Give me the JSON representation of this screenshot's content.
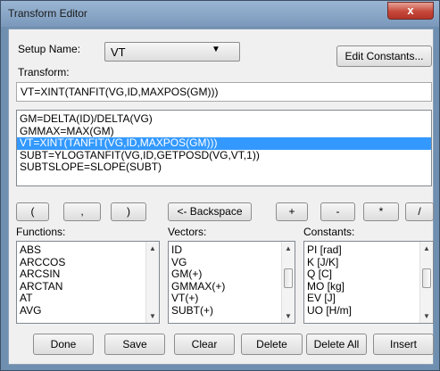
{
  "window": {
    "title": "Transform Editor",
    "close_glyph": "x"
  },
  "setup": {
    "label": "Setup Name:",
    "value": "VT",
    "arrow": "▼"
  },
  "edit_constants_label": "Edit Constants...",
  "transform": {
    "label": "Transform:",
    "value": "VT=XINT(TANFIT(VG,ID,MAXPOS(GM)))"
  },
  "transform_list": {
    "items": [
      "GM=DELTA(ID)/DELTA(VG)",
      "GMMAX=MAX(GM)",
      "VT=XINT(TANFIT(VG,ID,MAXPOS(GM)))",
      "SUBT=YLOGTANFIT(VG,ID,GETPOSD(VG,VT,1))",
      "SUBTSLOPE=SLOPE(SUBT)"
    ],
    "selected_index": 2
  },
  "keypad": {
    "open_paren": "(",
    "comma": ",",
    "close_paren": ")",
    "backspace": "<- Backspace",
    "plus": "+",
    "minus": "-",
    "multiply": "*",
    "divide": "/"
  },
  "functions": {
    "label": "Functions:",
    "items": [
      "ABS",
      "ARCCOS",
      "ARCSIN",
      "ARCTAN",
      "AT",
      "AVG"
    ]
  },
  "vectors": {
    "label": "Vectors:",
    "items": [
      "ID",
      "VG",
      "GM(+)",
      "GMMAX(+)",
      "VT(+)",
      "SUBT(+)"
    ]
  },
  "constants": {
    "label": "Constants:",
    "items": [
      "PI  [rad]",
      "K  [J/K]",
      "Q  [C]",
      "MO  [kg]",
      "EV  [J]",
      "UO  [H/m]"
    ]
  },
  "buttons": {
    "done": "Done",
    "save": "Save",
    "clear": "Clear",
    "delete": "Delete",
    "delete_all": "Delete All",
    "insert": "Insert"
  },
  "scroll_glyphs": {
    "up": "▲",
    "down": "▼"
  }
}
